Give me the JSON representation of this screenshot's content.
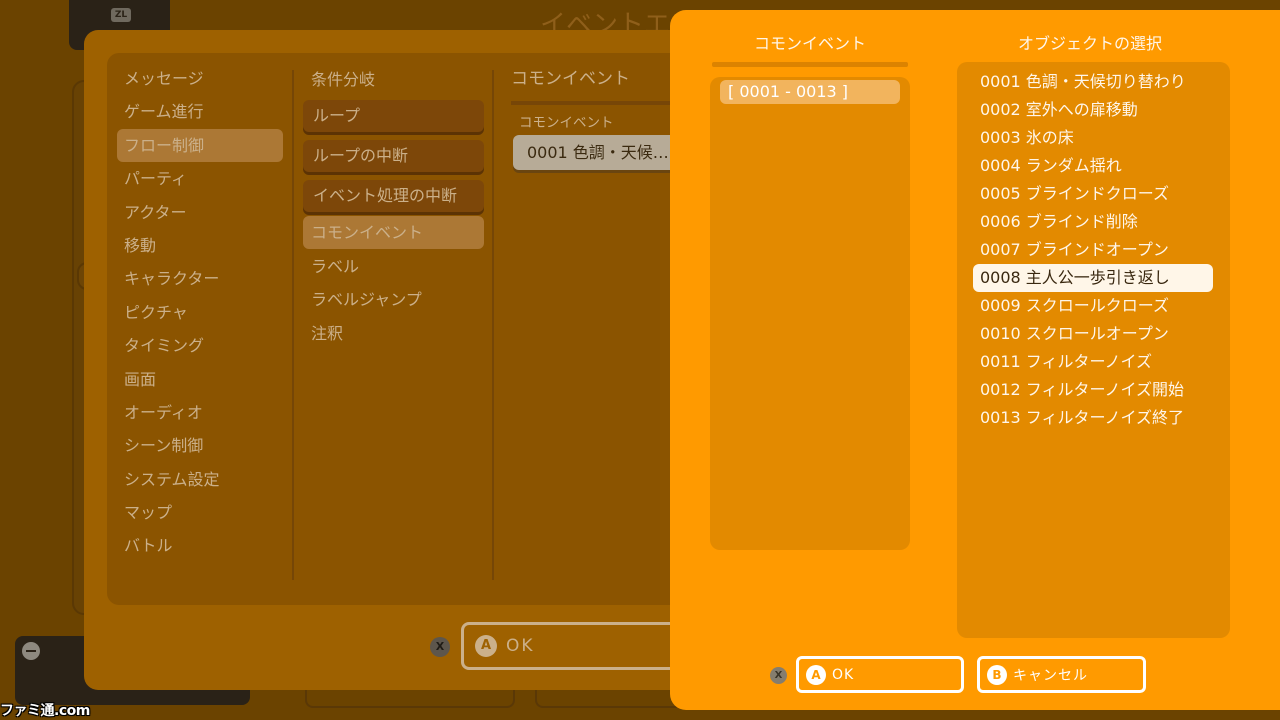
{
  "colors": {
    "page_bg": "#6b4300",
    "dialog_bg": "#9e6100",
    "dialog_inner_bg": "#8b5400",
    "dim_text": "#cbb08a",
    "dim_highlight": "#ac7835",
    "picker_bg": "#ff9a00",
    "picker_list_bg": "#e38a00",
    "picker_text": "#fff6ea",
    "selected_row_bg": "#fff6e8",
    "selected_row_text": "#3a2810"
  },
  "icons": {
    "background_minus_button": "minus-icon",
    "key_hints": [
      "x-button-icon",
      "a-button-icon",
      "b-button-icon"
    ]
  },
  "background_screen": {
    "title_fragment": "イベントエ",
    "zl_button": "ZL"
  },
  "event_dialog": {
    "categories": [
      "メッセージ",
      "ゲーム進行",
      "フロー制御",
      "パーティ",
      "アクター",
      "移動",
      "キャラクター",
      "ピクチャ",
      "タイミング",
      "画面",
      "オーディオ",
      "シーン制御",
      "システム設定",
      "マップ",
      "バトル"
    ],
    "selected_category_index": 2,
    "commands": [
      "条件分岐",
      "ループ",
      "ループの中断",
      "イベント処理の中断",
      "コモンイベント",
      "ラベル",
      "ラベルジャンプ",
      "注釈"
    ],
    "selected_command_index": 4,
    "settings": {
      "title": "コモンイベント",
      "field_label": "コモンイベント",
      "field_value": "0001 色調・天候…"
    },
    "footer": {
      "close_key": "X",
      "confirm_key": "A",
      "confirm_label": "OK"
    }
  },
  "common_event_picker": {
    "range_column_title": "コモンイベント",
    "ranges": [
      "[ 0001 - 0013 ]"
    ],
    "selected_range_index": 0,
    "object_column_title": "オブジェクトの選択",
    "objects": [
      "0001 色調・天候切り替わり",
      "0002 室外への扉移動",
      "0003 氷の床",
      "0004 ランダム揺れ",
      "0005 ブラインドクローズ",
      "0006 ブラインド削除",
      "0007 ブラインドオープン",
      "0008 主人公一歩引き返し",
      "0009 スクロールクローズ",
      "0010 スクロールオープン",
      "0011 フィルターノイズ",
      "0012 フィルターノイズ開始",
      "0013 フィルターノイズ終了"
    ],
    "selected_object_index": 7,
    "footer": {
      "close_key": "X",
      "confirm_key": "A",
      "confirm_label": "OK",
      "cancel_key": "B",
      "cancel_label": "キャンセル"
    }
  },
  "watermark": "ファミ通.com"
}
